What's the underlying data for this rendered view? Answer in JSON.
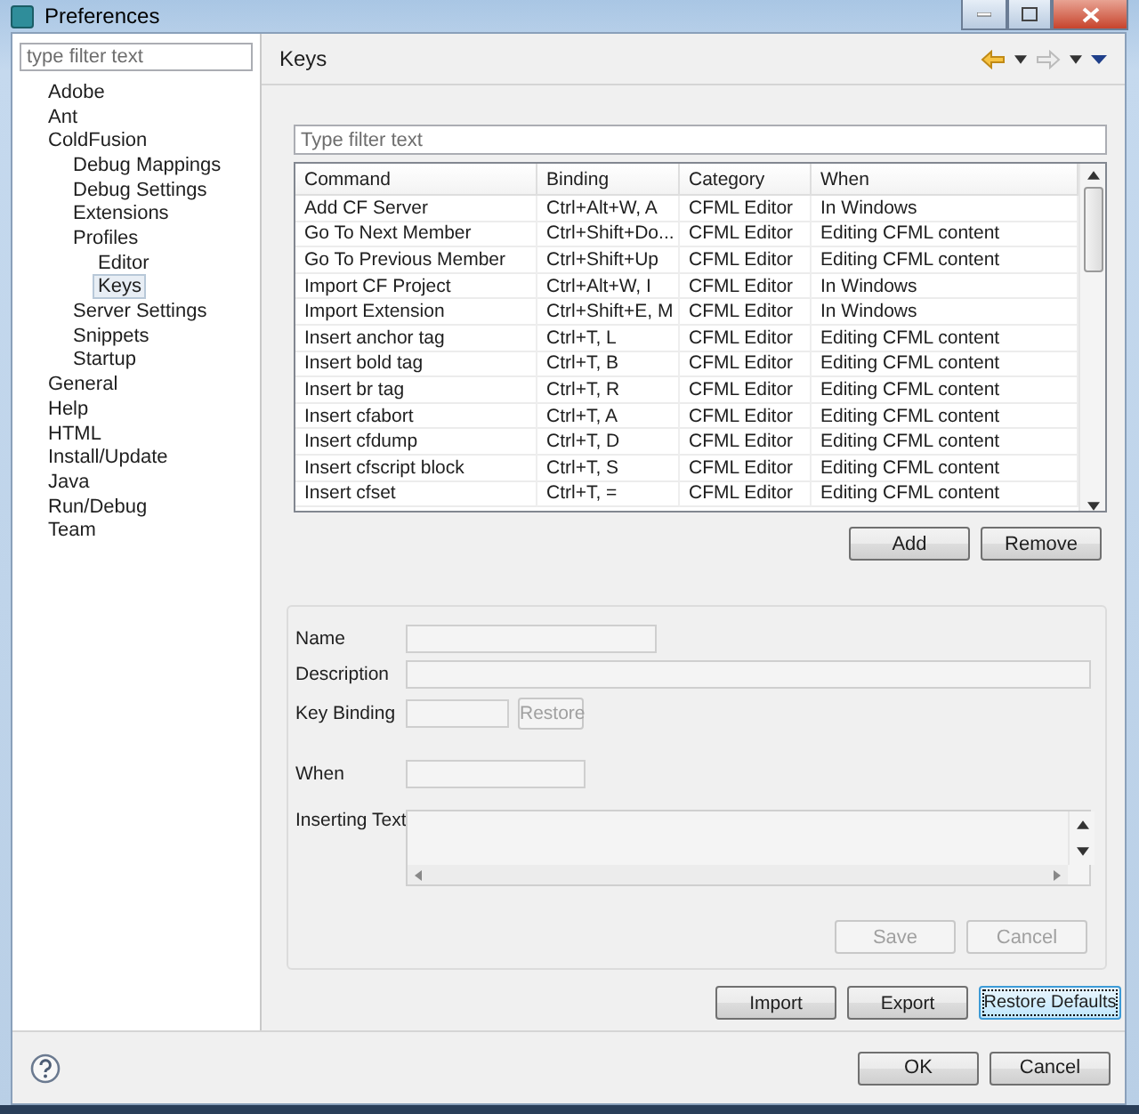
{
  "window": {
    "title": "Preferences"
  },
  "sidebar": {
    "filter": {
      "placeholder": "type filter text"
    },
    "tree": [
      {
        "label": "Adobe",
        "selected": false
      },
      {
        "label": "Ant",
        "selected": false
      },
      {
        "label": "ColdFusion",
        "selected": false,
        "children": [
          {
            "label": "Debug Mappings",
            "selected": false
          },
          {
            "label": "Debug Settings",
            "selected": false
          },
          {
            "label": "Extensions",
            "selected": false
          },
          {
            "label": "Profiles",
            "selected": false,
            "children": [
              {
                "label": "Editor",
                "selected": false
              },
              {
                "label": "Keys",
                "selected": true
              }
            ]
          },
          {
            "label": "Server Settings",
            "selected": false
          },
          {
            "label": "Snippets",
            "selected": false
          },
          {
            "label": "Startup",
            "selected": false
          }
        ]
      },
      {
        "label": "General",
        "selected": false
      },
      {
        "label": "Help",
        "selected": false
      },
      {
        "label": "HTML",
        "selected": false
      },
      {
        "label": "Install/Update",
        "selected": false
      },
      {
        "label": "Java",
        "selected": false
      },
      {
        "label": "Run/Debug",
        "selected": false
      },
      {
        "label": "Team",
        "selected": false
      }
    ]
  },
  "page": {
    "title": "Keys"
  },
  "table": {
    "filter": {
      "placeholder": "Type filter text"
    },
    "columns": [
      "Command",
      "Binding",
      "Category",
      "When"
    ],
    "rows": [
      [
        "Add CF Server",
        "Ctrl+Alt+W, A",
        "CFML Editor",
        "In Windows"
      ],
      [
        "Go To Next Member",
        "Ctrl+Shift+Do...",
        "CFML Editor",
        "Editing CFML content"
      ],
      [
        "Go To Previous Member",
        "Ctrl+Shift+Up",
        "CFML Editor",
        "Editing CFML content"
      ],
      [
        "Import CF Project",
        "Ctrl+Alt+W, I",
        "CFML Editor",
        "In Windows"
      ],
      [
        "Import Extension",
        "Ctrl+Shift+E, M",
        "CFML Editor",
        "In Windows"
      ],
      [
        "Insert anchor tag",
        "Ctrl+T, L",
        "CFML Editor",
        "Editing CFML content"
      ],
      [
        "Insert bold tag",
        "Ctrl+T, B",
        "CFML Editor",
        "Editing CFML content"
      ],
      [
        "Insert br tag",
        "Ctrl+T, R",
        "CFML Editor",
        "Editing CFML content"
      ],
      [
        "Insert cfabort",
        "Ctrl+T, A",
        "CFML Editor",
        "Editing CFML content"
      ],
      [
        "Insert cfdump",
        "Ctrl+T, D",
        "CFML Editor",
        "Editing CFML content"
      ],
      [
        "Insert cfscript block",
        "Ctrl+T, S",
        "CFML Editor",
        "Editing CFML content"
      ],
      [
        "Insert cfset",
        "Ctrl+T, =",
        "CFML Editor",
        "Editing CFML content"
      ]
    ]
  },
  "table_buttons": [
    {
      "label": "Add",
      "disabled": false
    },
    {
      "label": "Remove",
      "disabled": false
    }
  ],
  "form": {
    "fields": [
      {
        "label": "Name",
        "kind": "short"
      },
      {
        "label": "Description",
        "kind": "wide"
      },
      {
        "label": "Key Binding",
        "kind": "binding",
        "button": {
          "label": "Restore",
          "disabled": true
        }
      },
      {
        "label": "When",
        "kind": "medium"
      },
      {
        "label": "Inserting Text",
        "kind": "textarea"
      }
    ],
    "buttons": [
      {
        "label": "Save",
        "disabled": true
      },
      {
        "label": "Cancel",
        "disabled": true
      }
    ]
  },
  "page_buttons": [
    {
      "label": "Import",
      "focused": false
    },
    {
      "label": "Export",
      "focused": false
    },
    {
      "label": "Restore Defaults",
      "focused": true
    }
  ],
  "dialog_buttons": [
    "OK",
    "Cancel"
  ]
}
